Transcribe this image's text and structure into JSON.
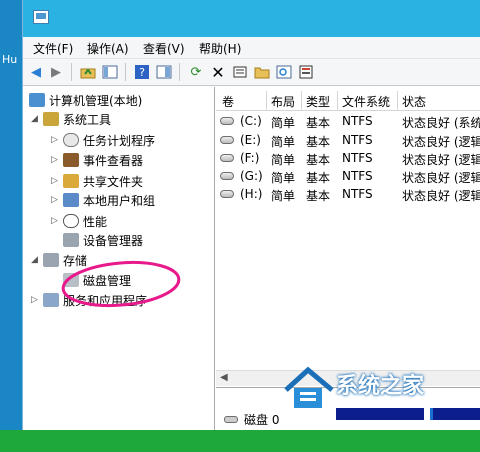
{
  "desktop": {
    "left_text": "Hu"
  },
  "menu": [
    "文件(F)",
    "操作(A)",
    "查看(V)",
    "帮助(H)"
  ],
  "toolbar_icons": [
    "back-arrow-icon",
    "forward-arrow-icon",
    "folder-up-icon",
    "show-tree-icon",
    "help-icon",
    "properties-icon",
    "refresh-icon",
    "delete-icon",
    "properties-sheet-icon",
    "open-folder-icon",
    "search-icon",
    "export-list-icon"
  ],
  "tree": {
    "root": "计算机管理(本地)",
    "system_tools": "系统工具",
    "task_scheduler": "任务计划程序",
    "event_viewer": "事件查看器",
    "shared_folders": "共享文件夹",
    "local_users": "本地用户和组",
    "performance": "性能",
    "device_manager": "设备管理器",
    "storage": "存储",
    "disk_management": "磁盘管理",
    "services_apps": "服务和应用程序"
  },
  "list": {
    "columns": [
      "卷",
      "布局",
      "类型",
      "文件系统",
      "状态"
    ],
    "rows": [
      {
        "volume": "(C:)",
        "layout": "简单",
        "type": "基本",
        "fs": "NTFS",
        "status": "状态良好 (系统"
      },
      {
        "volume": "(E:)",
        "layout": "简单",
        "type": "基本",
        "fs": "NTFS",
        "status": "状态良好 (逻辑"
      },
      {
        "volume": "(F:)",
        "layout": "简单",
        "type": "基本",
        "fs": "NTFS",
        "status": "状态良好 (逻辑"
      },
      {
        "volume": "(G:)",
        "layout": "简单",
        "type": "基本",
        "fs": "NTFS",
        "status": "状态良好 (逻辑"
      },
      {
        "volume": "(H:)",
        "layout": "简单",
        "type": "基本",
        "fs": "NTFS",
        "status": "状态良好 (逻辑"
      }
    ],
    "disk_label": "磁盘 0"
  },
  "watermark": {
    "title": "系统之家",
    "subtitle": "XITONGZHIJIA.NET"
  },
  "colors": {
    "titlebar": "#2ab3e2",
    "desktop": "#2aa8df",
    "partition_bar": "#0b1e8c",
    "highlight_circle": "#e8198b"
  }
}
